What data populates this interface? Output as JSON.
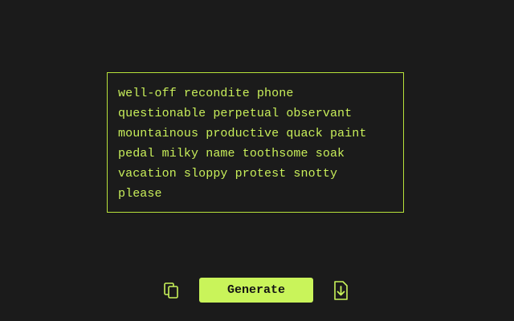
{
  "output": {
    "text": "well-off recondite phone\nquestionable perpetual observant\nmountainous productive quack paint\npedal milky name toothsome soak\nvacation sloppy protest snotty\nplease"
  },
  "toolbar": {
    "copy_icon": "copy-icon",
    "generate_label": "Generate",
    "download_icon": "download-icon"
  },
  "colors": {
    "background": "#1b1b1b",
    "accent": "#c9f45a",
    "text": "#c8ee5a"
  }
}
